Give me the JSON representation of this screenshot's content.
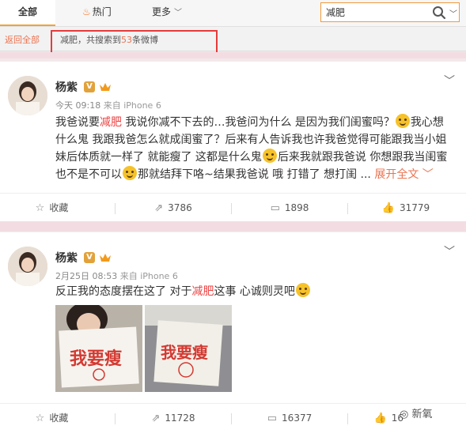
{
  "nav": {
    "tab_all": "全部",
    "tab_hot": "热门",
    "tab_more": "更多"
  },
  "search": {
    "value": "减肥"
  },
  "results": {
    "back_label": "返回全部",
    "info_prefix": "减肥，共搜索到",
    "count": "53",
    "info_suffix": "条微博"
  },
  "posts": [
    {
      "user": "杨紫",
      "time": "今天 09:18",
      "source": "来自 iPhone 6",
      "text_parts": [
        "我爸说要",
        "减肥",
        " 我说你减不下去的…我爸问为什么 是因为我们闺蜜吗？",
        "我心想什么鬼 我跟我爸怎么就成闺蜜了？后来有人告诉我也许我爸觉得可能跟我当小姐妹后体质就一样了 就能瘦了 这都是什么鬼",
        "后来我就跟我爸说 你想跟我当闺蜜也不是不可以",
        "那就结拜下咯~结果我爸说 哦 打错了 想打闺 ..."
      ],
      "more": "展开全文",
      "actions": {
        "fav": "收藏",
        "repost": "3786",
        "comment": "1898",
        "like": "31779"
      }
    },
    {
      "user": "杨紫",
      "time": "2月25日 08:53",
      "source": "来自 iPhone 6",
      "text_parts": [
        "反正我的态度摆在这了 对于",
        "减肥",
        "这事 心诚则灵吧"
      ],
      "images": [
        {
          "caption": "我要瘦"
        },
        {
          "caption": "我要瘦"
        }
      ],
      "actions": {
        "fav": "收藏",
        "repost": "11728",
        "comment": "16377",
        "like": "16"
      }
    }
  ],
  "watermark": "新氧"
}
